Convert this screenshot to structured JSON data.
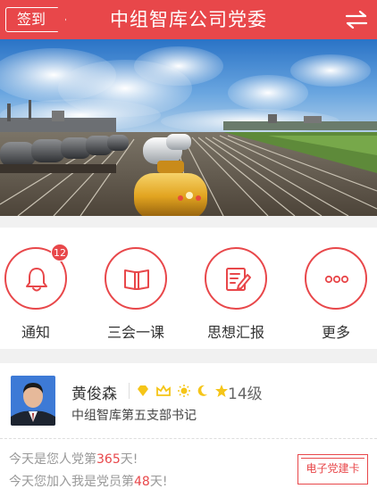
{
  "header": {
    "signin_label": "签到",
    "title": "中组智库公司党委"
  },
  "quick_actions": [
    {
      "label": "通知",
      "badge": "12"
    },
    {
      "label": "三会一课"
    },
    {
      "label": "思想汇报"
    },
    {
      "label": "更多"
    }
  ],
  "profile": {
    "name": "黄俊森",
    "level_text": "14级",
    "role": "中组智库第五支部书记",
    "party_days_prefix": "今天是您人党第",
    "party_days_value": "365",
    "party_days_suffix": "天!",
    "member_days_prefix": "今天您加入我是党员第",
    "member_days_value": "48",
    "member_days_suffix": "天!",
    "card_button_label": "电子党建卡"
  },
  "colors": {
    "accent": "#e8474a"
  }
}
